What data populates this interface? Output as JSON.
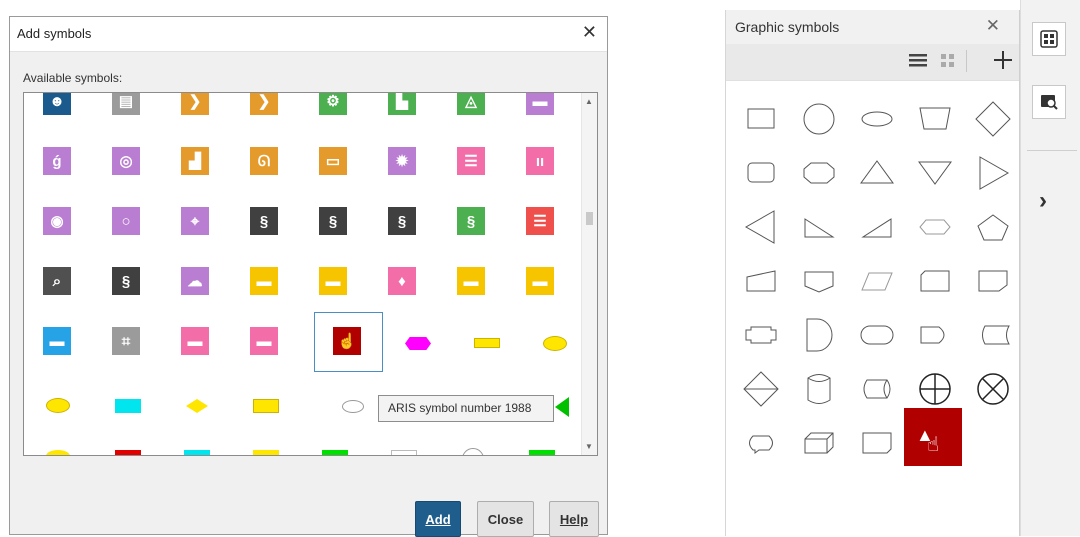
{
  "dialog": {
    "title": "Add symbols",
    "close_glyph": "✕",
    "available_label": "Available symbols:",
    "tooltip": "ARIS symbol number 1988",
    "buttons": {
      "add": "Add",
      "close": "Close",
      "help": "Help"
    }
  },
  "panel": {
    "title": "Graphic symbols",
    "close_glyph": "✕",
    "toolbar": [
      "list-view-icon",
      "grid-view-icon",
      "add-icon"
    ]
  },
  "sidebar": {
    "buttons": [
      "symbol-palette-icon",
      "search-symbol-icon"
    ],
    "chevron": "›"
  },
  "colors": {
    "accent": "#1f5d8c",
    "selected_symbol": "#b00000",
    "purple": "#b97ed2",
    "orange": "#e49b2b",
    "green": "#4caf50",
    "gray": "#404040",
    "yellow": "#f6c500",
    "blue": "#26a3e6",
    "pink": "#f36ea8",
    "red": "#f0504b"
  }
}
